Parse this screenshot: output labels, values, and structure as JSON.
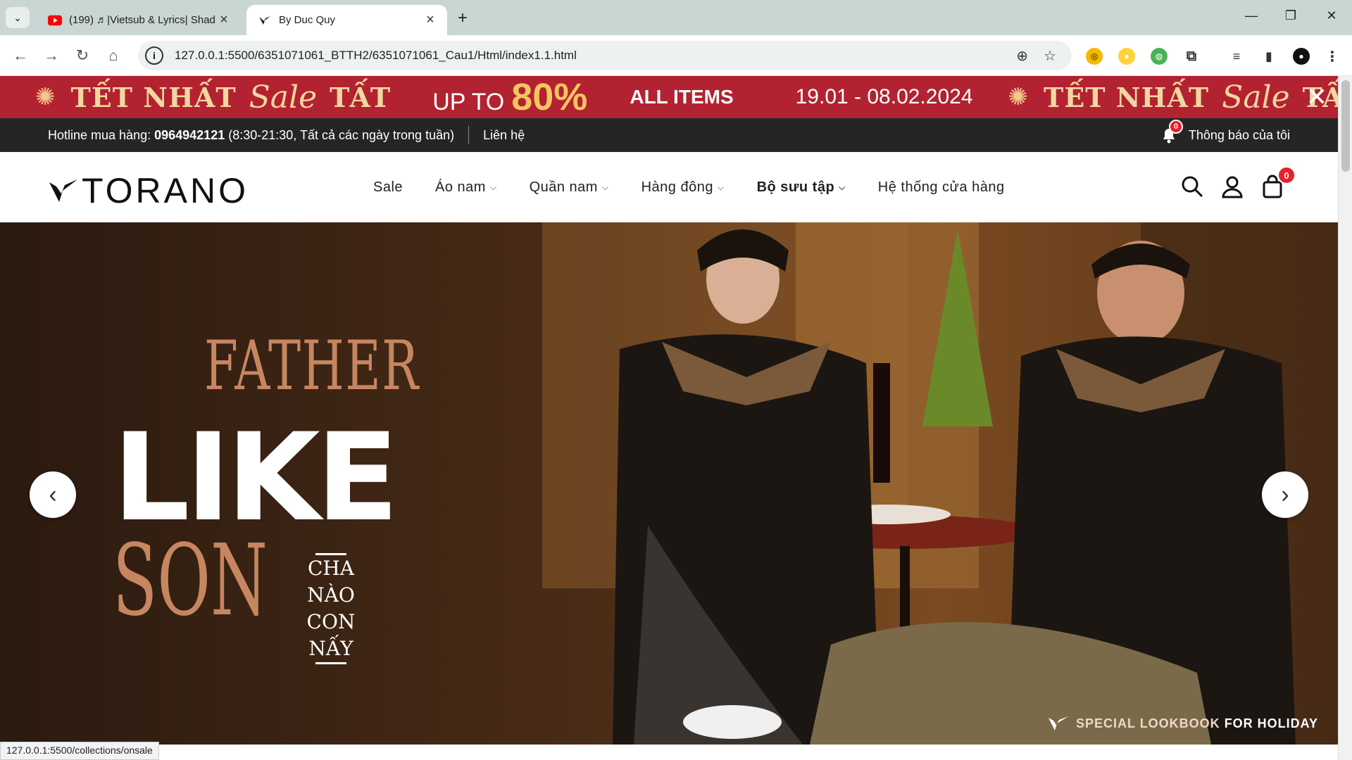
{
  "browser": {
    "tabs": [
      {
        "title": "(199) ♬|Vietsub & Lyrics| Shad",
        "active": false,
        "favicon": "youtube-icon"
      },
      {
        "title": "By Duc Quy",
        "active": true,
        "favicon": "torano-icon"
      }
    ],
    "url": "127.0.0.1:5500/6351071061_BTTH2/6351071061_Cau1/Html/index1.1.html",
    "status_url": "127.0.0.1:5500/collections/onsale"
  },
  "promo": {
    "tet": "TẾT NHẤT",
    "sale": "Sale",
    "tat": "TẤT",
    "upto": "UP TO",
    "percent": "80%",
    "all_items": "ALL ITEMS",
    "dates": "19.01 - 08.02.2024"
  },
  "topbar": {
    "hotline_label": "Hotline mua hàng:",
    "hotline_number": "0964942121",
    "hotline_hours": "(8:30-21:30, Tất cả các ngày trong tuần)",
    "contact": "Liên hệ",
    "notification_label": "Thông báo của tôi",
    "notification_count": "0"
  },
  "header": {
    "logo": "TORANO",
    "menu": [
      {
        "label": "Sale",
        "dropdown": false
      },
      {
        "label": "Áo nam",
        "dropdown": true
      },
      {
        "label": "Quần nam",
        "dropdown": true
      },
      {
        "label": "Hàng đông",
        "dropdown": true
      },
      {
        "label": "Bộ sưu tập",
        "dropdown": true
      },
      {
        "label": "Hệ thống cửa hàng",
        "dropdown": false
      }
    ],
    "cart_count": "0"
  },
  "hero": {
    "father": "FATHER",
    "like": "LIKE",
    "son": "SON",
    "cha_nao": "CHA NÀO",
    "con_nay": "CON NẤY",
    "lookbook_prefix": "SPECIAL LOOKBOOK",
    "lookbook_suffix": "FOR HOLIDAY"
  },
  "colors": {
    "promo_red": "#b22231",
    "topbar_dark": "#252525",
    "badge_red": "#e8202a",
    "accent_copper": "#c68660"
  }
}
